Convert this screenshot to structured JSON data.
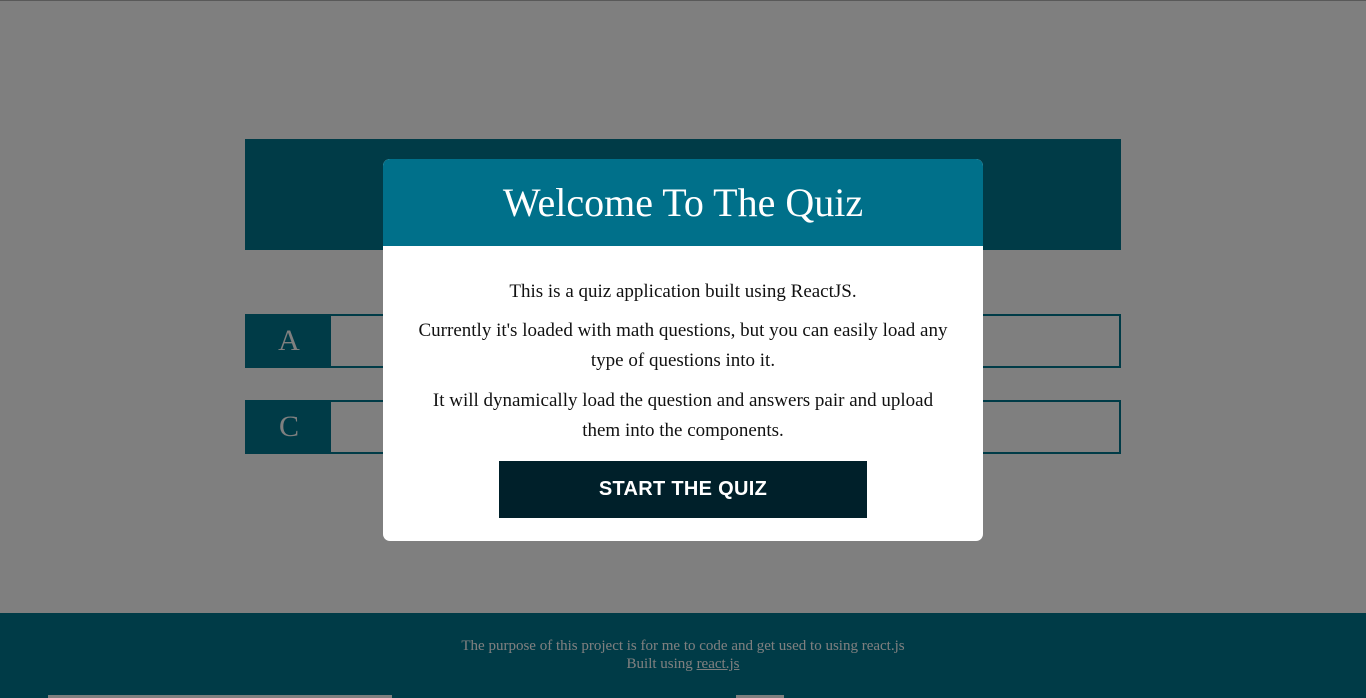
{
  "quiz": {
    "answers": [
      {
        "letter": "A"
      },
      {
        "letter": "C"
      }
    ]
  },
  "modal": {
    "title": "Welcome To The Quiz",
    "paragraphs": [
      "This is a quiz application built using ReactJS.",
      "Currently it's loaded with math questions, but you can easily load any type of questions into it.",
      "It will dynamically load the question and answers pair and upload them into the components."
    ],
    "start_button": "START THE QUIZ"
  },
  "footer": {
    "purpose": "The purpose of this project is for me to code and get used to using react.js",
    "built_using_prefix": "Built using ",
    "link_text": "react.js"
  },
  "colors": {
    "primary": "#00778f",
    "modal_header": "#00708a",
    "button": "#00202a",
    "overlay": "rgba(0,0,0,0.5)"
  }
}
